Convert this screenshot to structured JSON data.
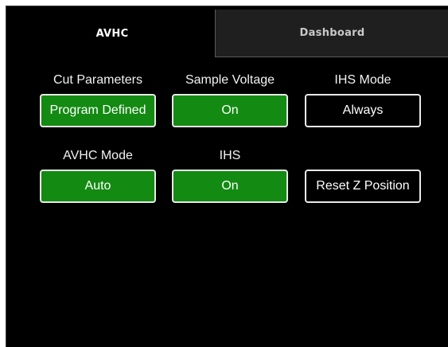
{
  "tabs": [
    {
      "label": "AVHC",
      "active": true
    },
    {
      "label": "Dashboard",
      "active": false
    }
  ],
  "controls": {
    "cut_parameters": {
      "label": "Cut Parameters",
      "value": "Program Defined"
    },
    "sample_voltage": {
      "label": "Sample Voltage",
      "value": "On"
    },
    "ihs_mode": {
      "label": "IHS Mode",
      "value": "Always"
    },
    "avhc_mode": {
      "label": "AVHC Mode",
      "value": "Auto"
    },
    "ihs": {
      "label": "IHS",
      "value": "On"
    },
    "reset_z": {
      "label": "Reset Z Position"
    }
  },
  "colors": {
    "active_button": "#138a12",
    "background": "#000000",
    "inactive_tab": "#1f1f1f",
    "border": "#e9e9e9"
  }
}
